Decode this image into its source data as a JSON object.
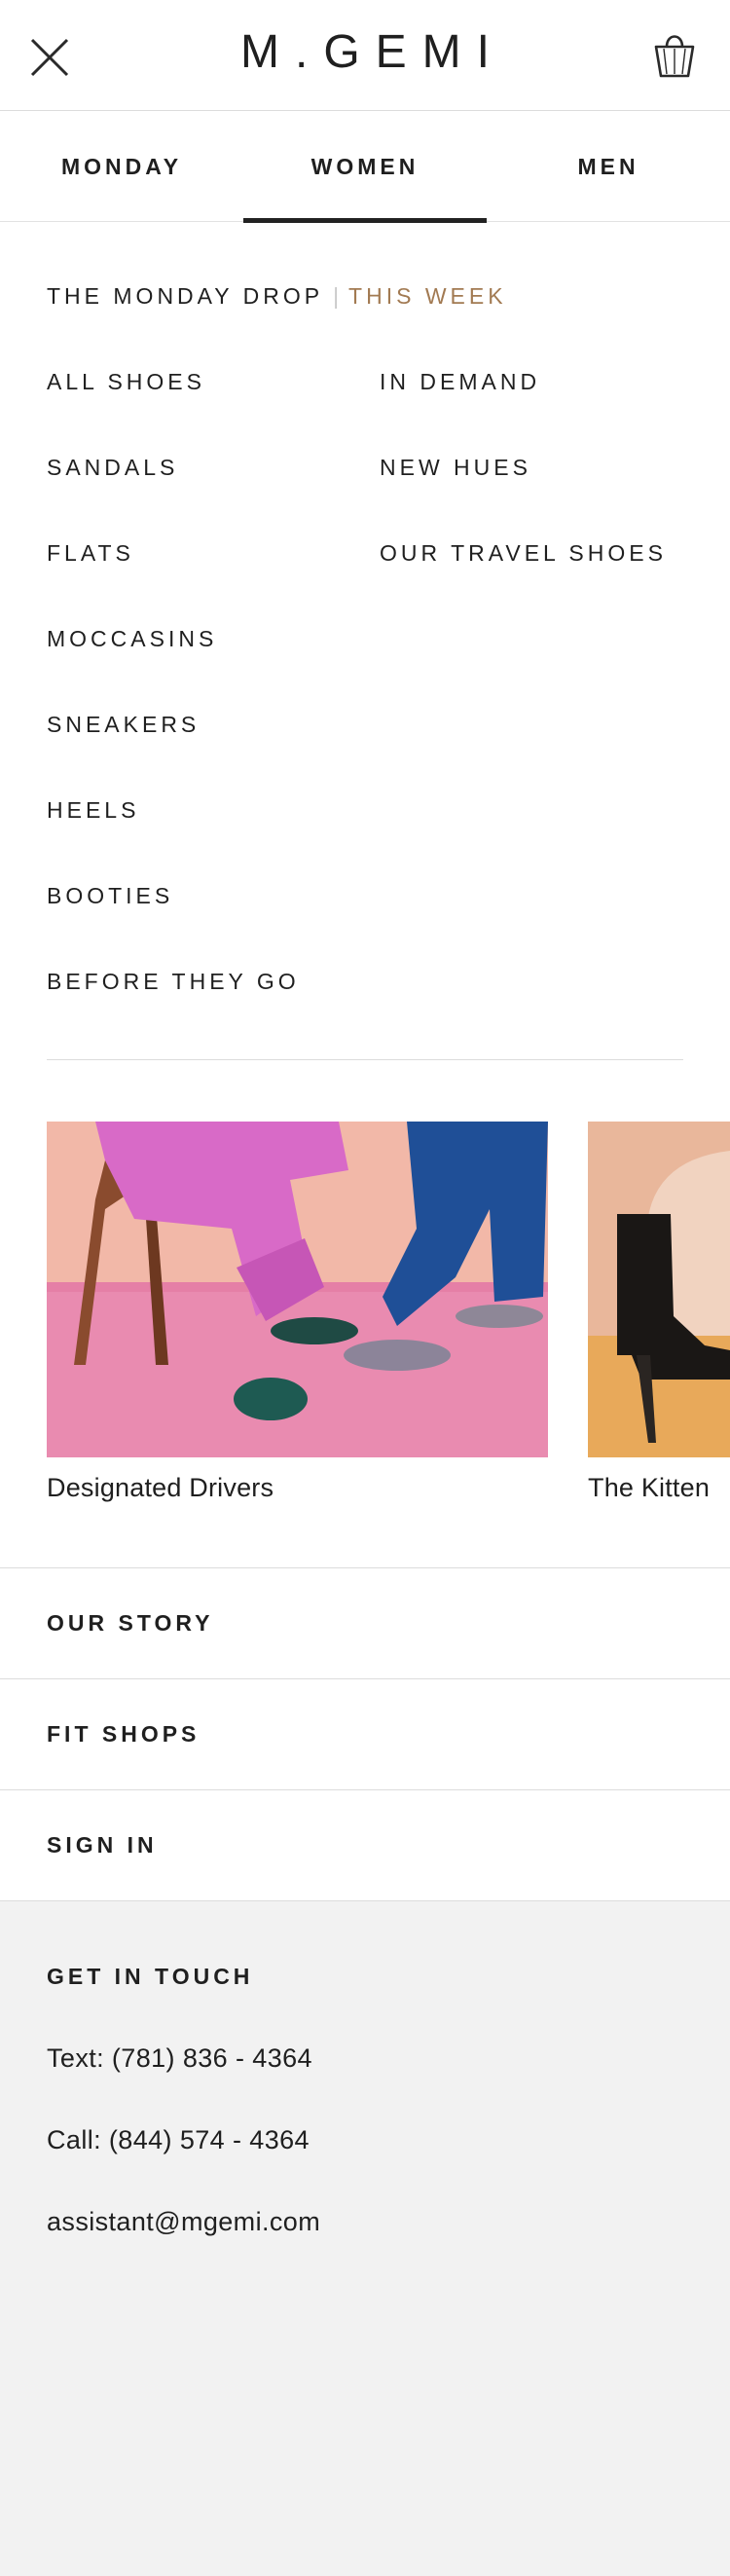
{
  "header": {
    "logo": "M.GEMI",
    "icons": [
      "close-icon",
      "shopping-bag-icon"
    ]
  },
  "tabs": [
    {
      "label": "MONDAY",
      "active": false
    },
    {
      "label": "WOMEN",
      "active": true
    },
    {
      "label": "MEN",
      "active": false
    }
  ],
  "menu": {
    "drop_label": "THE MONDAY DROP",
    "drop_separator": "|",
    "drop_highlight": "THIS WEEK",
    "left_column": [
      "ALL SHOES",
      "SANDALS",
      "FLATS",
      "MOCCASINS",
      "SNEAKERS",
      "HEELS",
      "BOOTIES",
      "BEFORE THEY GO"
    ],
    "right_column": [
      "IN DEMAND",
      "NEW HUES",
      "OUR TRAVEL SHOES"
    ]
  },
  "features": [
    {
      "caption": "Designated Drivers"
    },
    {
      "caption": "The Kitten"
    }
  ],
  "links": {
    "our_story": "OUR STORY",
    "fit_shops": "FIT SHOPS",
    "sign_in": "SIGN IN"
  },
  "contact": {
    "title": "GET IN TOUCH",
    "text": "Text: (781) 836 - 4364",
    "call": "Call: (844) 574 - 4364",
    "email": "assistant@mgemi.com"
  },
  "colors": {
    "accent": "#a27a52",
    "text": "#1f1f1f",
    "contact_bg": "#f2f2f2"
  }
}
